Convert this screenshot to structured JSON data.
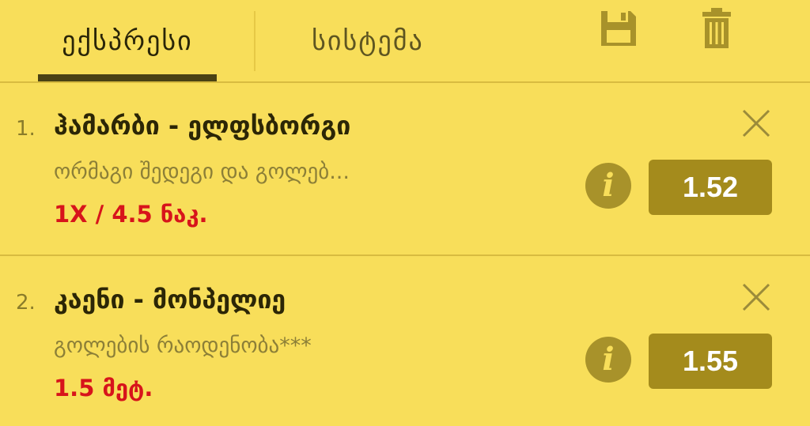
{
  "tabs": [
    {
      "label": "ექსპრესი",
      "active": true
    },
    {
      "label": "სისტემა",
      "active": false
    }
  ],
  "toolbar": {
    "save_icon": "save-icon",
    "trash_icon": "trash-icon"
  },
  "bets": [
    {
      "number": "1.",
      "title": "ჰამარბი - ელფსბორგი",
      "market": "ორმაგი შედეგი და გოლებ...",
      "selection": "1X / 4.5 ნაკ.",
      "odds": "1.52"
    },
    {
      "number": "2.",
      "title": "კაენი - მონპელიე",
      "market": "გოლების რაოდენობა***",
      "selection": "1.5 მეტ.",
      "odds": "1.55"
    }
  ],
  "colors": {
    "background": "#f8de5a",
    "odds_button": "#a48b1c",
    "selection_text": "#d7141b",
    "active_tab_underline": "#4a4214"
  }
}
